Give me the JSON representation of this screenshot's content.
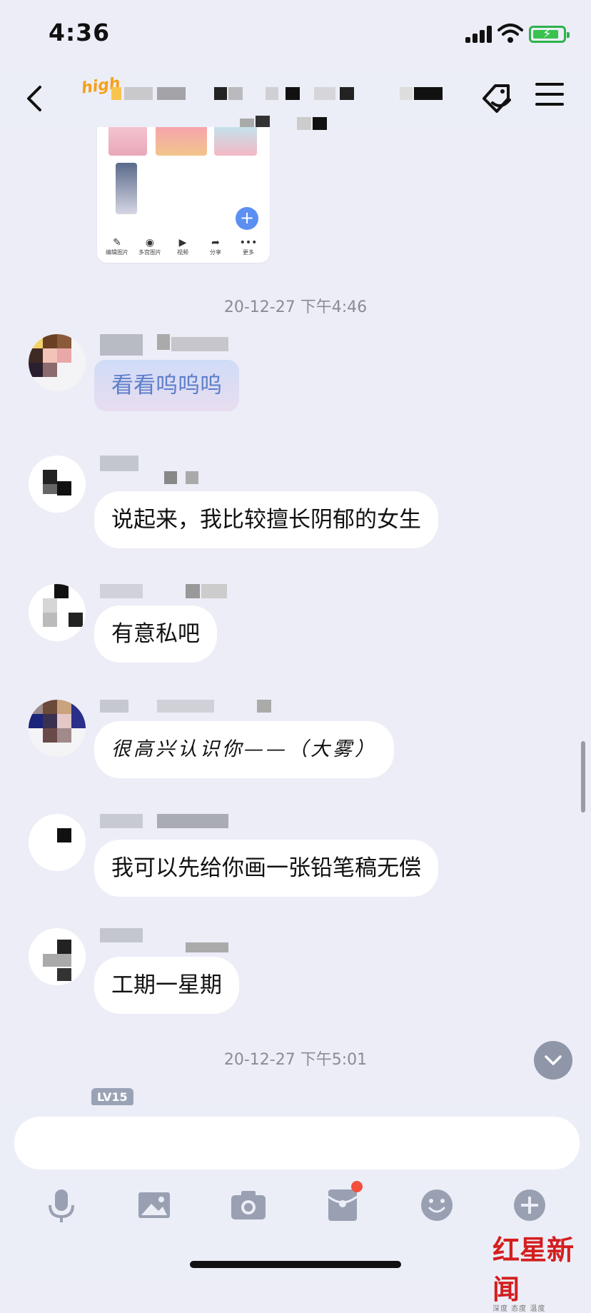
{
  "status_bar": {
    "time": "4:36"
  },
  "nav": {
    "badge_text": "high"
  },
  "image_card": {
    "tools": [
      "编辑图片",
      "多宫图片",
      "视频",
      "分享",
      "更多"
    ]
  },
  "messages": [
    {
      "type": "timestamp",
      "text": "20-12-27 下午4:46"
    },
    {
      "type": "message",
      "style": "fancy",
      "text": "看看呜呜呜"
    },
    {
      "type": "message",
      "style": "plain",
      "text": "说起来，我比较擅长阴郁的女生"
    },
    {
      "type": "message",
      "style": "plain",
      "text": "有意私吧"
    },
    {
      "type": "message",
      "style": "script",
      "text": "很高兴认识你——（大雾）"
    },
    {
      "type": "message",
      "style": "plain",
      "text": "我可以先给你画一张铅笔稿无偿"
    },
    {
      "type": "message",
      "style": "plain",
      "text": "工期一星期"
    },
    {
      "type": "timestamp",
      "text": "20-12-27 下午5:01"
    }
  ],
  "level_badge": "LV15",
  "input": {
    "value": "",
    "placeholder": ""
  },
  "watermark": {
    "brand": "红星新闻",
    "tagline": "深度 态度 温度"
  },
  "colors": {
    "background": "#ecedf7",
    "bubble": "#ffffff",
    "fab": "#5b8ff2",
    "notify": "#f34f3f"
  }
}
